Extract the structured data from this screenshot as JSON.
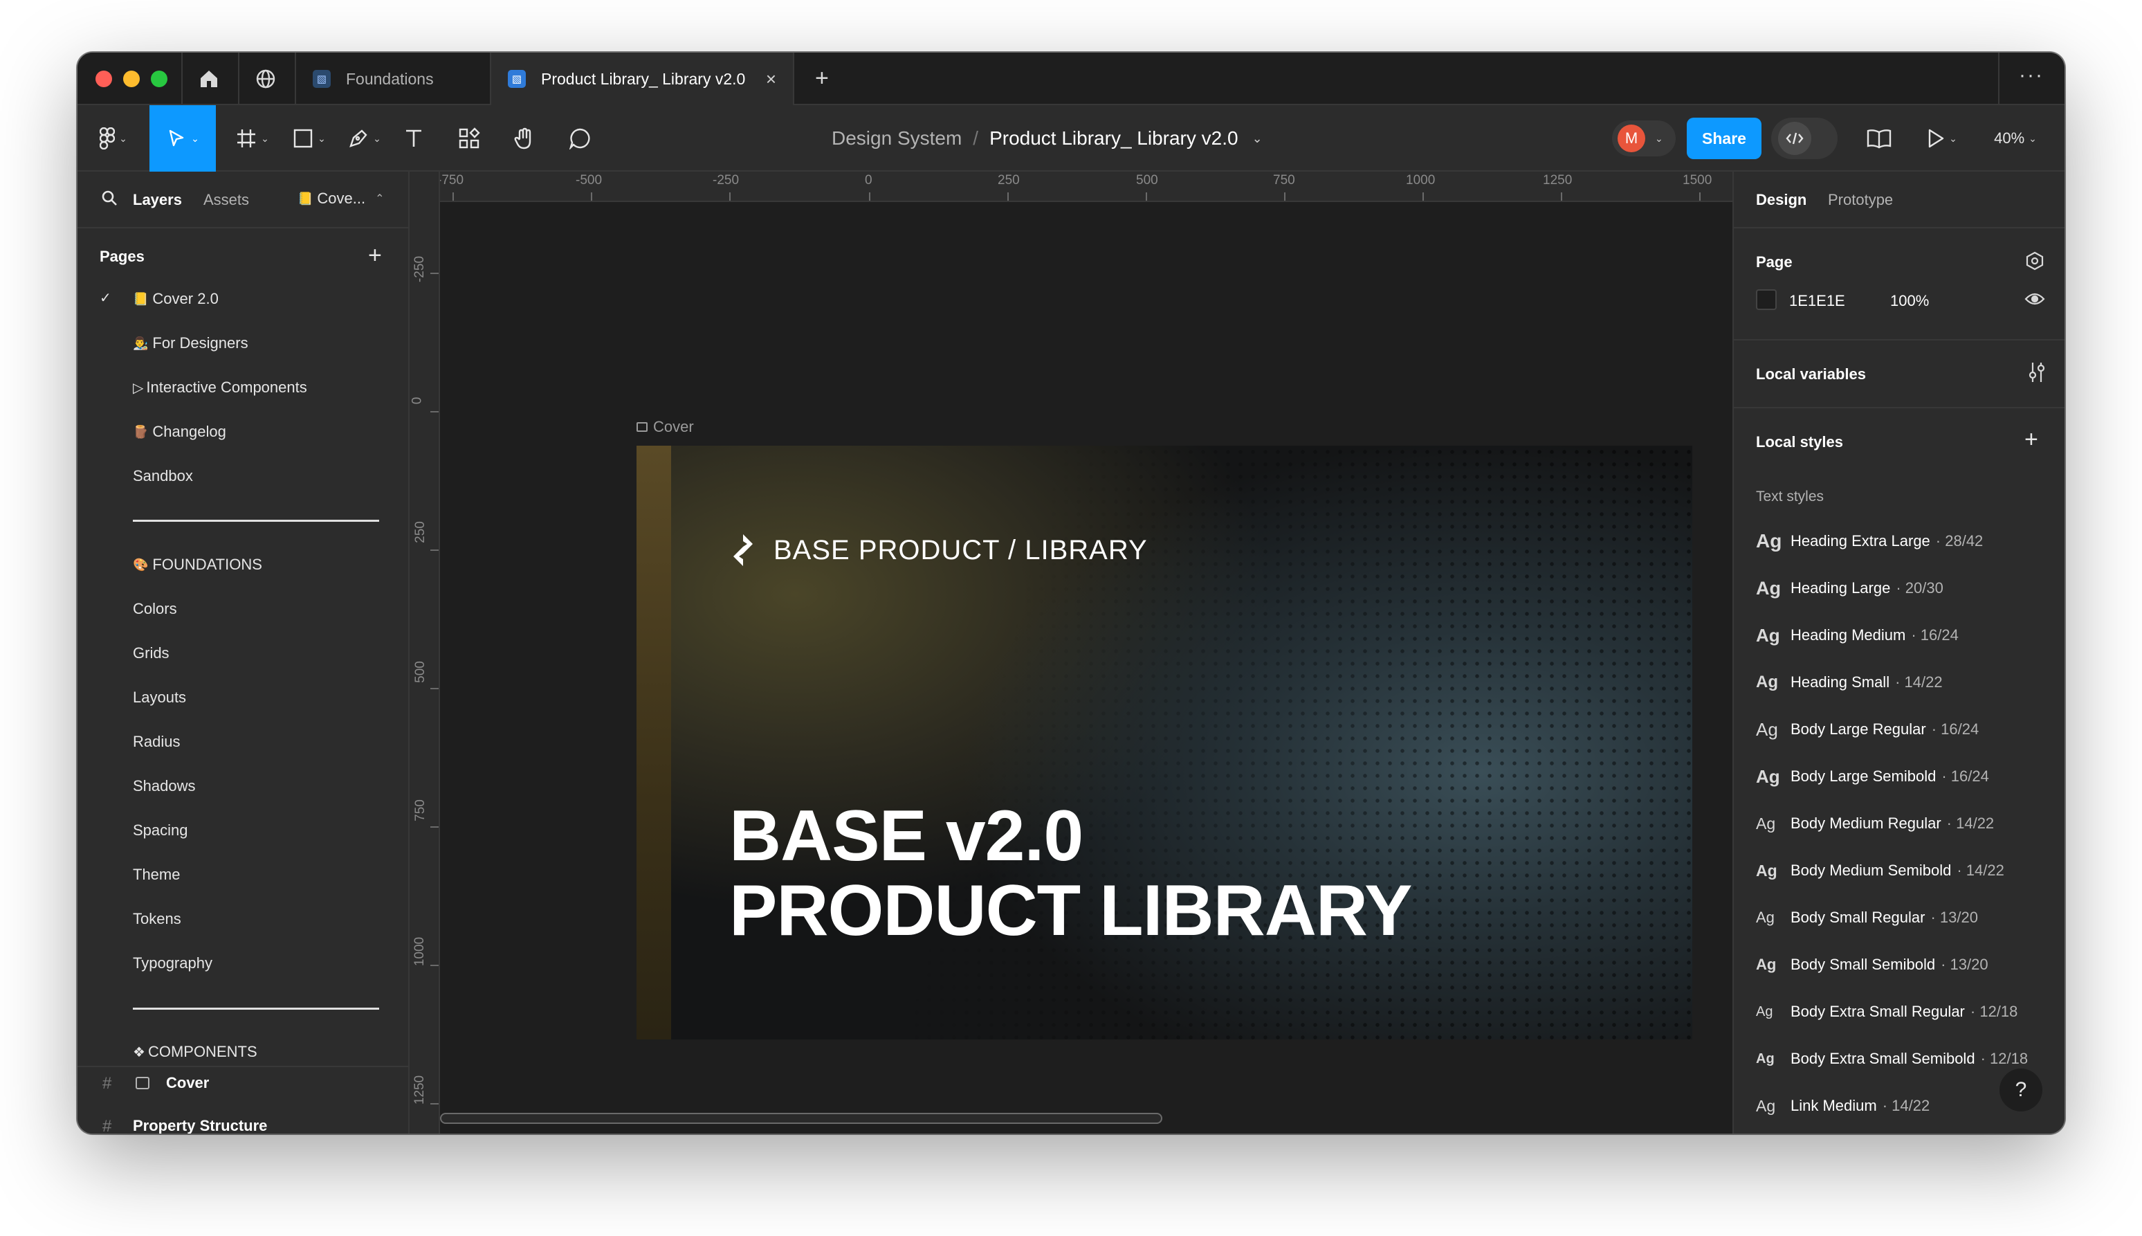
{
  "tabs": [
    {
      "label": "Foundations"
    },
    {
      "label": "Product Library_ Library v2.0"
    }
  ],
  "breadcrumb": {
    "project": "Design System",
    "separator": "/",
    "file": "Product Library_ Library v2.0"
  },
  "toolbar": {
    "share_label": "Share",
    "zoom": "40%",
    "avatar_initial": "M"
  },
  "left_tabs": {
    "layers": "Layers",
    "assets": "Assets",
    "page": "Cove..."
  },
  "pages": {
    "title": "Pages",
    "items": [
      {
        "label": "Cover 2.0",
        "emoji": "📒",
        "selected": true
      },
      {
        "label": "For Designers",
        "emoji": "👨‍🎨"
      },
      {
        "label": "Interactive Components",
        "emoji": "▷"
      },
      {
        "label": "Changelog",
        "emoji": "🪵"
      },
      {
        "label": "Sandbox",
        "emoji": ""
      },
      {
        "label": "FOUNDATIONS",
        "emoji": "🎨"
      },
      {
        "label": "Colors"
      },
      {
        "label": "Grids"
      },
      {
        "label": "Layouts"
      },
      {
        "label": "Radius"
      },
      {
        "label": "Shadows"
      },
      {
        "label": "Spacing"
      },
      {
        "label": "Theme"
      },
      {
        "label": "Tokens"
      },
      {
        "label": "Typography"
      },
      {
        "label": "COMPONENTS",
        "emoji": "❖"
      }
    ]
  },
  "layers": {
    "items": [
      {
        "label": "Cover"
      },
      {
        "label": "Property Structure"
      }
    ]
  },
  "canvas": {
    "frame_label": "Cover",
    "ruler_h": [
      "-750",
      "-500",
      "-250",
      "0",
      "250",
      "500",
      "750",
      "1000",
      "1250",
      "1500"
    ],
    "ruler_v": [
      "-250",
      "0",
      "250",
      "500",
      "750",
      "1000",
      "1250"
    ],
    "cover_brand": "BASE PRODUCT / LIBRARY",
    "cover_title_1": "BASE v2.0",
    "cover_title_2": "PRODUCT LIBRARY"
  },
  "right_tabs": {
    "design": "Design",
    "prototype": "Prototype"
  },
  "page_section": {
    "title": "Page",
    "color": "1E1E1E",
    "opacity": "100%"
  },
  "local_variables": {
    "title": "Local variables"
  },
  "local_styles": {
    "title": "Local styles",
    "subtitle": "Text styles",
    "items": [
      {
        "ag": "Ag",
        "name": "Heading Extra Large",
        "size": "· 28/42"
      },
      {
        "ag": "Ag",
        "name": "Heading Large",
        "size": "· 20/30"
      },
      {
        "ag": "Ag",
        "name": "Heading Medium",
        "size": "· 16/24"
      },
      {
        "ag": "Ag",
        "name": "Heading Small",
        "size": "· 14/22"
      },
      {
        "ag": "Ag",
        "name": "Body Large Regular",
        "size": "· 16/24"
      },
      {
        "ag": "Ag",
        "name": "Body Large Semibold",
        "size": "· 16/24"
      },
      {
        "ag": "Ag",
        "name": "Body Medium Regular",
        "size": "· 14/22"
      },
      {
        "ag": "Ag",
        "name": "Body Medium Semibold",
        "size": "· 14/22"
      },
      {
        "ag": "Ag",
        "name": "Body Small Regular",
        "size": "· 13/20"
      },
      {
        "ag": "Ag",
        "name": "Body Small Semibold",
        "size": "· 13/20"
      },
      {
        "ag": "Ag",
        "name": "Body Extra Small Regular",
        "size": "· 12/18"
      },
      {
        "ag": "Ag",
        "name": "Body Extra Small Semibold",
        "size": "· 12/18"
      },
      {
        "ag": "Ag",
        "name": "Link Medium",
        "size": "· 14/22"
      }
    ]
  },
  "help": {
    "label": "?"
  },
  "colors": {
    "accent": "#0d99ff",
    "avatar": "#e8553b",
    "select_tool": "#0d99ff"
  }
}
